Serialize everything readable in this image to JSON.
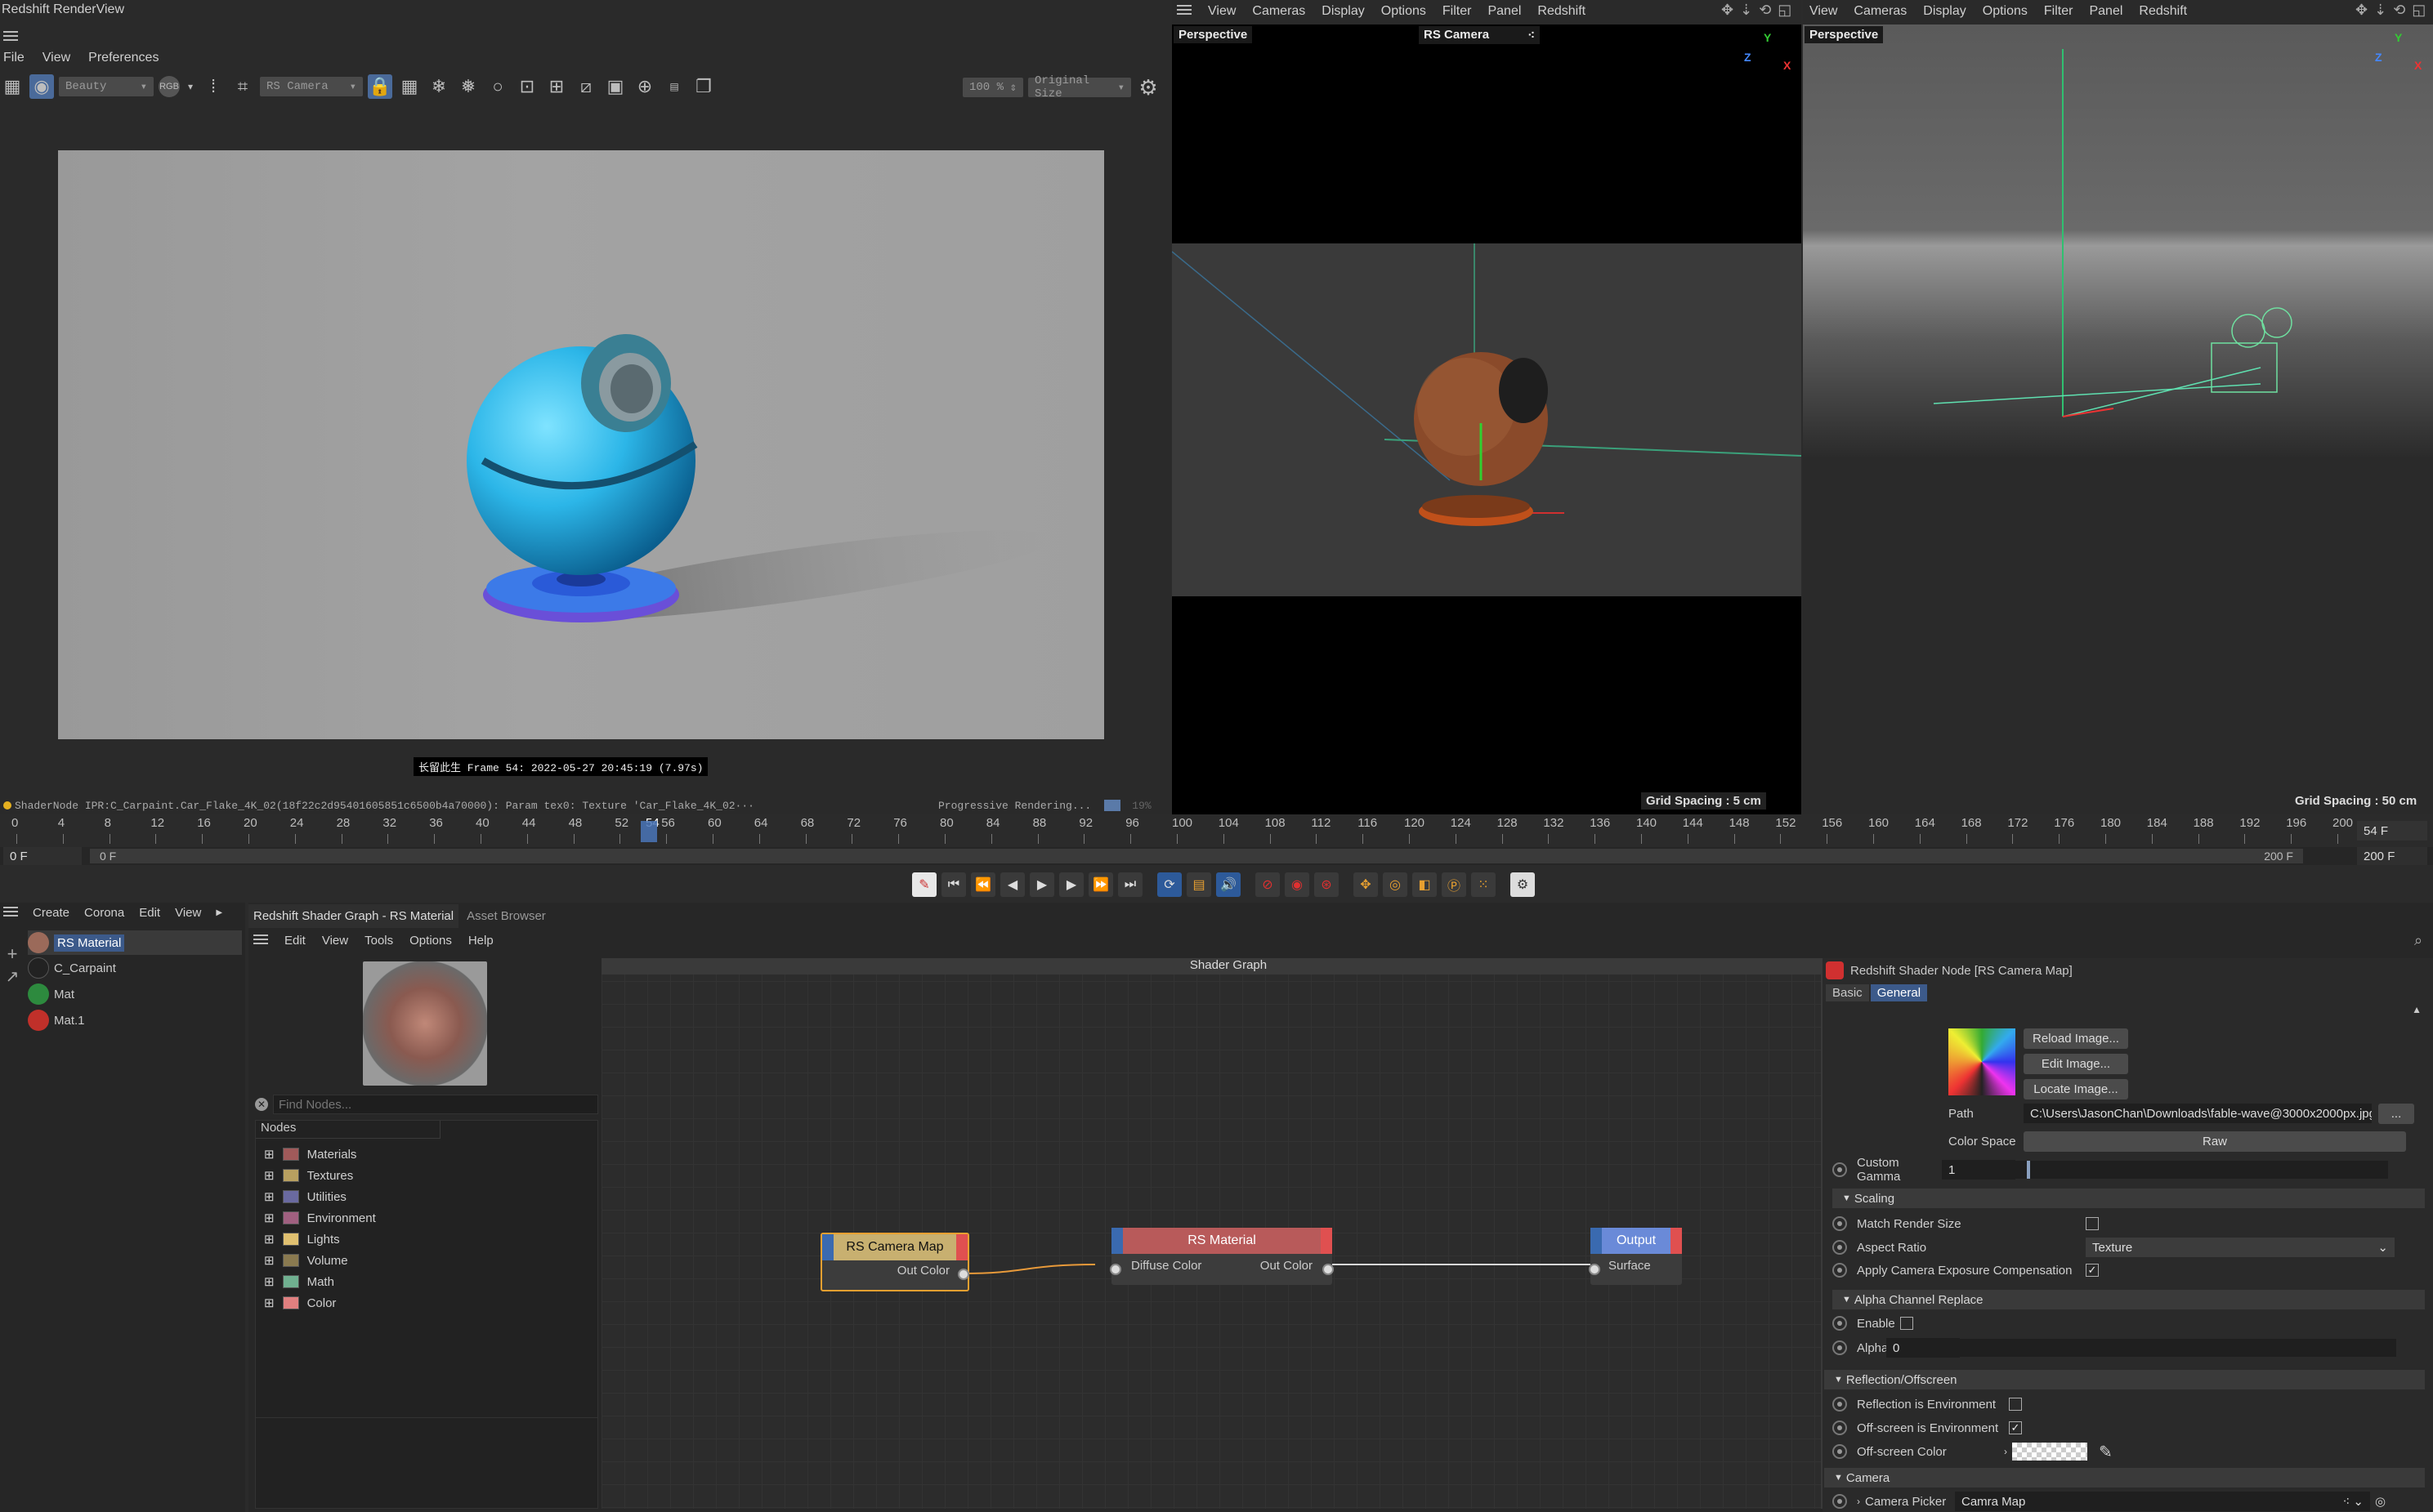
{
  "renderview": {
    "title": "Redshift RenderView",
    "menu": [
      "File",
      "View",
      "Preferences"
    ],
    "aov_dropdown": "Beauty",
    "rgb_label": "RGB",
    "camera_dropdown": "RS Camera",
    "zoom": "100 %",
    "size_dropdown": "Original Size",
    "caption": "长留此生 Frame 54: 2022-05-27 20:45:19 (7.97s)",
    "status": "ShaderNode IPR:C_Carpaint.Car_Flake_4K_02(18f22c2d95401605851c6500b4a70000): Param tex0: Texture 'Car_Flake_4K_02···",
    "progress_text": "Progressive Rendering...",
    "progress_pct": "19%",
    "progress_value": 0.19
  },
  "viewport1": {
    "menu": [
      "View",
      "Cameras",
      "Display",
      "Options",
      "Filter",
      "Panel",
      "Redshift"
    ],
    "label": "Perspective",
    "camera_label": "RS Camera",
    "grid_spacing": "Grid Spacing : 5 cm"
  },
  "viewport2": {
    "menu": [
      "View",
      "Cameras",
      "Display",
      "Options",
      "Filter",
      "Panel",
      "Redshift"
    ],
    "label": "Perspective",
    "grid_spacing": "Grid Spacing : 50 cm"
  },
  "timeline": {
    "ticks": [
      "0",
      "4",
      "8",
      "12",
      "16",
      "20",
      "24",
      "28",
      "32",
      "36",
      "40",
      "44",
      "48",
      "52",
      "56",
      "60",
      "64",
      "68",
      "72",
      "76",
      "80",
      "84",
      "88",
      "92",
      "96",
      "100",
      "104",
      "108",
      "112",
      "116",
      "120",
      "124",
      "128",
      "132",
      "136",
      "140",
      "144",
      "148",
      "152",
      "156",
      "160",
      "164",
      "168",
      "172",
      "176",
      "180",
      "184",
      "188",
      "192",
      "196",
      "200"
    ],
    "current_frame_marker": "54",
    "current_frame": "54 F",
    "start_field": "0 F",
    "range_start": "0 F",
    "range_end": "200 F",
    "end_field": "200 F"
  },
  "material_manager": {
    "menu": [
      "Create",
      "Corona",
      "Edit",
      "View"
    ],
    "items": [
      {
        "name": "RS Material",
        "color": "#9b6a5a"
      },
      {
        "name": "C_Carpaint",
        "color": "#222222"
      },
      {
        "name": "Mat",
        "color": "#2d8a3e"
      },
      {
        "name": "Mat.1",
        "color": "#c0302a"
      }
    ]
  },
  "shader_tabs": {
    "active": "Redshift Shader Graph - RS Material",
    "inactive": "Asset Browser",
    "menu": [
      "Edit",
      "View",
      "Tools",
      "Options",
      "Help"
    ]
  },
  "node_browser": {
    "search_placeholder": "Find Nodes...",
    "header": "Nodes",
    "categories": [
      {
        "label": "Materials",
        "color": "#a05a5a"
      },
      {
        "label": "Textures",
        "color": "#b8a060"
      },
      {
        "label": "Utilities",
        "color": "#6a6aa0"
      },
      {
        "label": "Environment",
        "color": "#a06080"
      },
      {
        "label": "Lights",
        "color": "#e0c070"
      },
      {
        "label": "Volume",
        "color": "#8a7a50"
      },
      {
        "label": "Math",
        "color": "#70b090"
      },
      {
        "label": "Color",
        "color": "#e08080"
      }
    ]
  },
  "graph": {
    "title": "Shader Graph",
    "nodes": {
      "camera_map": {
        "title": "RS Camera Map",
        "out": "Out Color"
      },
      "material": {
        "title": "RS Material",
        "in": "Diffuse Color",
        "out": "Out Color"
      },
      "output": {
        "title": "Output",
        "in": "Surface"
      }
    }
  },
  "attributes": {
    "title": "Redshift Shader Node [RS Camera Map]",
    "tabs": [
      "Basic",
      "General"
    ],
    "active_tab": "General",
    "buttons": [
      "Reload Image...",
      "Edit Image...",
      "Locate Image..."
    ],
    "path_label": "Path",
    "path_value": "C:\\Users\\JasonChan\\Downloads\\fable-wave@3000x2000px.jpg",
    "path_more": "...",
    "color_space_label": "Color Space",
    "color_space_value": "Raw",
    "custom_gamma_label": "Custom Gamma",
    "custom_gamma_value": "1",
    "scaling_header": "Scaling",
    "match_render_size": "Match Render Size",
    "aspect_ratio_label": "Aspect Ratio",
    "aspect_ratio_value": "Texture",
    "apply_cam_exposure": "Apply Camera Exposure Compensation",
    "alpha_header": "Alpha Channel Replace",
    "enable_label": "Enable",
    "alpha_label": "Alpha",
    "alpha_value": "0",
    "reflection_header": "Reflection/Offscreen",
    "reflection_env": "Reflection is Environment",
    "offscreen_env": "Off-screen is Environment",
    "offscreen_color": "Off-screen Color",
    "camera_header": "Camera",
    "camera_picker_label": "Camera Picker",
    "camera_picker_value": "Camra Map"
  }
}
